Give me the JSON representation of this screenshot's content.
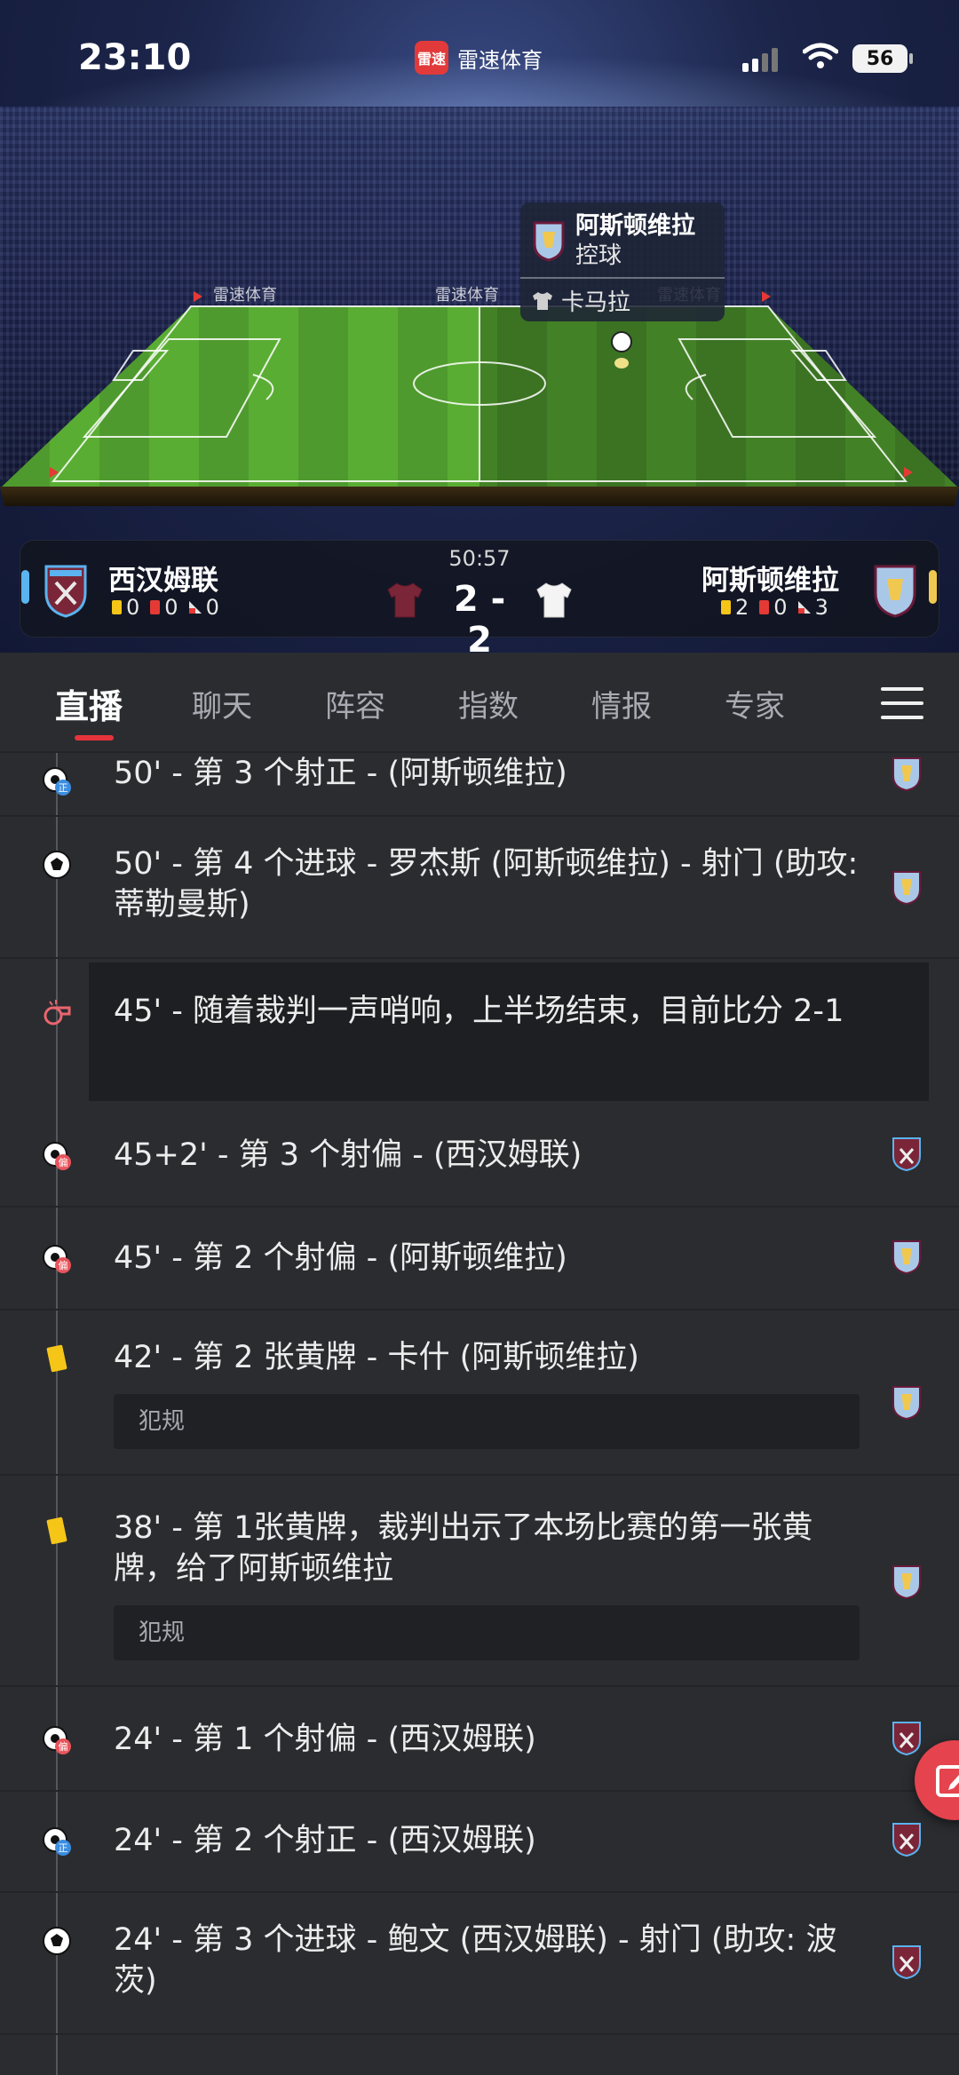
{
  "status_bar": {
    "time": "23:10",
    "app_logo_text": "雷速",
    "app_name": "雷速体育",
    "battery": "56"
  },
  "stadium": {
    "board_text": "雷速体育"
  },
  "possession": {
    "team": "阿斯顿维拉",
    "action": "控球",
    "player": "卡马拉"
  },
  "match": {
    "minute": "50:57",
    "score": "2 - 2",
    "home": {
      "name": "西汉姆联",
      "yellow": "0",
      "red": "0",
      "corners": "0",
      "edge_color": "#5bb3ef"
    },
    "away": {
      "name": "阿斯顿维拉",
      "yellow": "2",
      "red": "0",
      "corners": "3",
      "edge_color": "#f0c850"
    }
  },
  "tabs": [
    {
      "label": "直播",
      "active": true
    },
    {
      "label": "聊天"
    },
    {
      "label": "阵容"
    },
    {
      "label": "指数"
    },
    {
      "label": "情报"
    },
    {
      "label": "专家"
    }
  ],
  "events": [
    {
      "text": "50' - 第 3 个射正 - (阿斯顿维拉)",
      "icon": "shot-on-target-icon",
      "team": "aston-villa"
    },
    {
      "text": "50' - 第 4 个进球 - 罗杰斯 (阿斯顿维拉) - 射门 (助攻: 蒂勒曼斯)",
      "icon": "goal-ball-icon",
      "team": "aston-villa"
    },
    {
      "text": "45' - 随着裁判一声哨响，上半场结束，目前比分 2-1",
      "icon": "whistle-icon",
      "team": ""
    },
    {
      "text": "45+2' - 第 3 个射偏 - (西汉姆联)",
      "icon": "shot-off-target-icon",
      "team": "west-ham"
    },
    {
      "text": "45' - 第 2 个射偏 - (阿斯顿维拉)",
      "icon": "shot-off-target-icon",
      "team": "aston-villa"
    },
    {
      "text": "42' - 第 2 张黄牌 - 卡什 (阿斯顿维拉)",
      "note": "犯规",
      "icon": "yellow-card-icon",
      "team": "aston-villa"
    },
    {
      "text": "38' - 第 1张黄牌，裁判出示了本场比赛的第一张黄牌，给了阿斯顿维拉",
      "note": "犯规",
      "icon": "yellow-card-icon",
      "team": "aston-villa"
    },
    {
      "text": "24' - 第 1 个射偏 - (西汉姆联)",
      "icon": "shot-off-target-icon",
      "team": "west-ham"
    },
    {
      "text": "24' - 第 2 个射正 - (西汉姆联)",
      "icon": "shot-on-target-icon",
      "team": "west-ham"
    },
    {
      "text": "24' - 第 3 个进球 - 鲍文 (西汉姆联) - 射门 (助攻: 波茨)",
      "icon": "goal-ball-icon",
      "team": "west-ham"
    }
  ],
  "colors": {
    "accent": "#e5343c",
    "background": "#2a2c30",
    "yellow_card": "#f5c518",
    "red_card": "#e53935"
  }
}
